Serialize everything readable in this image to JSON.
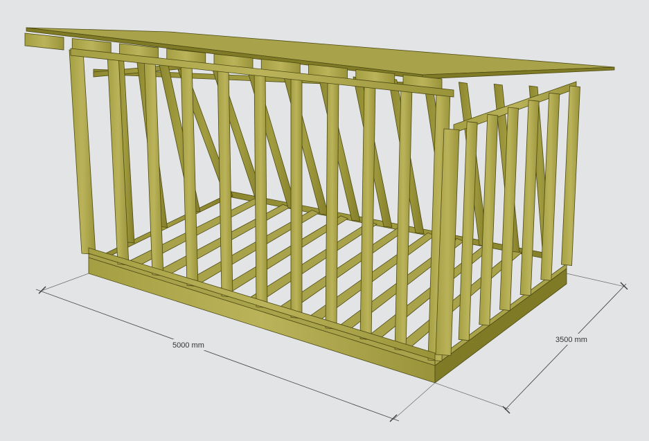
{
  "dimensions": {
    "length": {
      "label": "5000 mm",
      "value": 5000,
      "unit": "mm"
    },
    "depth": {
      "label": "3500 mm",
      "value": 3500,
      "unit": "mm"
    }
  },
  "colors": {
    "background": "#e3e4e5",
    "timber_light": "#b5ae55",
    "timber_mid": "#9c9638",
    "timber_dark": "#6f6a1e",
    "outline": "#4d4a13",
    "dimension_line": "#4b4b4b"
  }
}
